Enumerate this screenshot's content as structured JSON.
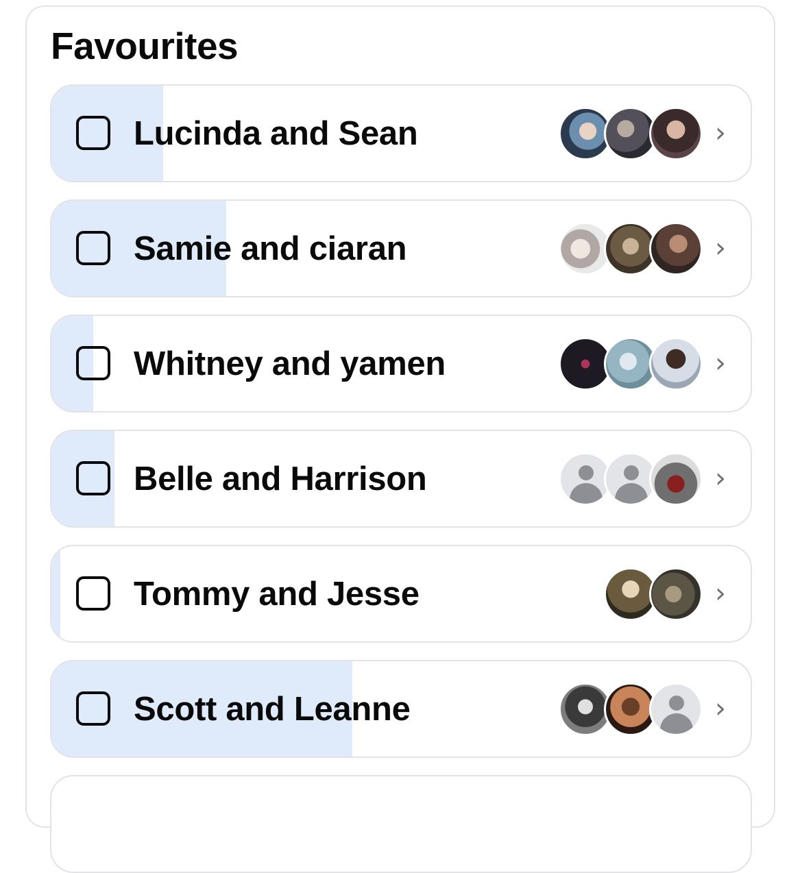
{
  "section": {
    "title": "Favourites"
  },
  "rows": [
    {
      "label": "Lucinda and Sean",
      "progress_fraction": 0.16,
      "avatars": [
        "photo",
        "photo",
        "photo"
      ]
    },
    {
      "label": "Samie and ciaran",
      "progress_fraction": 0.25,
      "avatars": [
        "photo",
        "photo",
        "photo"
      ]
    },
    {
      "label": "Whitney and yamen",
      "progress_fraction": 0.06,
      "avatars": [
        "photo",
        "photo",
        "photo"
      ]
    },
    {
      "label": "Belle and Harrison",
      "progress_fraction": 0.09,
      "avatars": [
        "person-placeholder-icon",
        "person-placeholder-icon",
        "photo"
      ]
    },
    {
      "label": "Tommy and Jesse",
      "progress_fraction": 0.013,
      "avatars": [
        "photo",
        "photo"
      ]
    },
    {
      "label": "Scott and Leanne",
      "progress_fraction": 0.43,
      "avatars": [
        "photo",
        "photo",
        "person-placeholder-icon"
      ]
    }
  ],
  "colors": {
    "progress_fill": "#dfeafb",
    "row_border": "#e3e3e6",
    "chevron": "#6e6e73"
  }
}
